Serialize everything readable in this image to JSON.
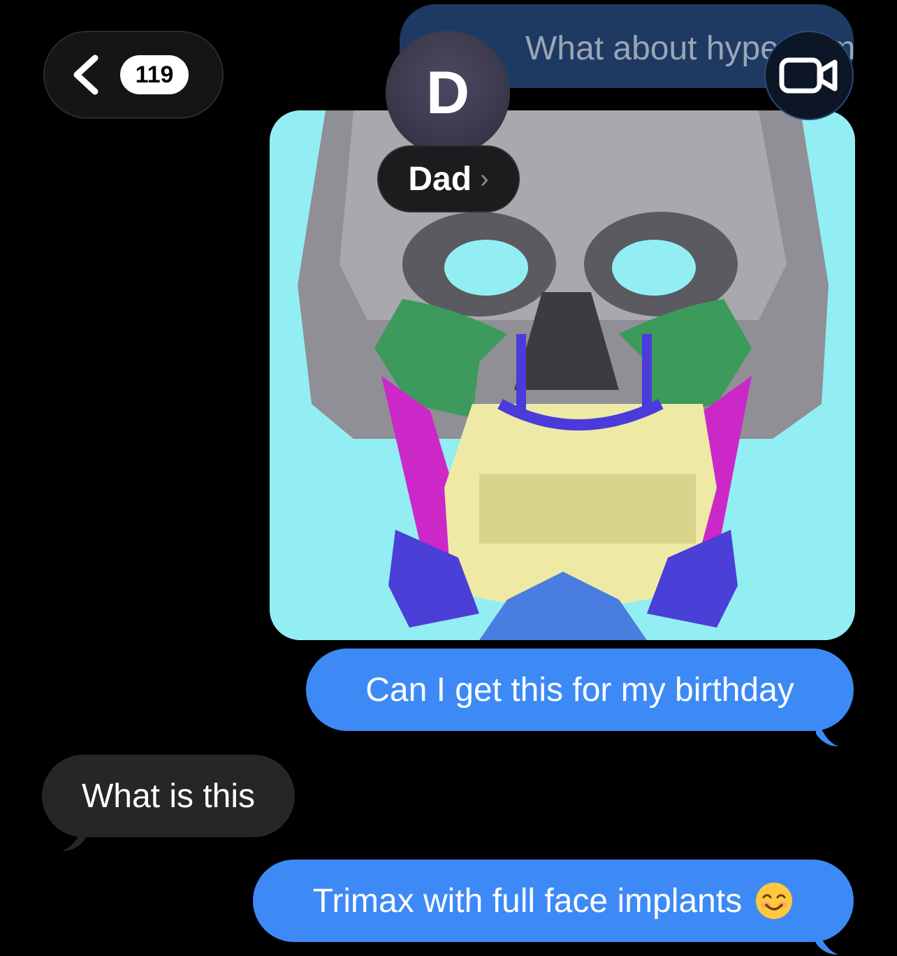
{
  "previous_message": {
    "text": "What about hypergamy"
  },
  "header": {
    "back_badge": "119",
    "contact_initial": "D",
    "contact_name": "Dad",
    "name_chevron": "›"
  },
  "colors": {
    "outgoing_bubble": "#3d8af7",
    "incoming_bubble": "#262628",
    "background": "#000000"
  },
  "messages": [
    {
      "side": "outgoing",
      "type": "image",
      "description_icon": "skull-implant-render"
    },
    {
      "side": "outgoing",
      "type": "text",
      "text": "Can I get this for my birthday"
    },
    {
      "side": "incoming",
      "type": "text",
      "text": "What is this"
    },
    {
      "side": "outgoing",
      "type": "text",
      "text": "Trimax with full face implants",
      "emoji": "smiling-face-emoji"
    }
  ]
}
